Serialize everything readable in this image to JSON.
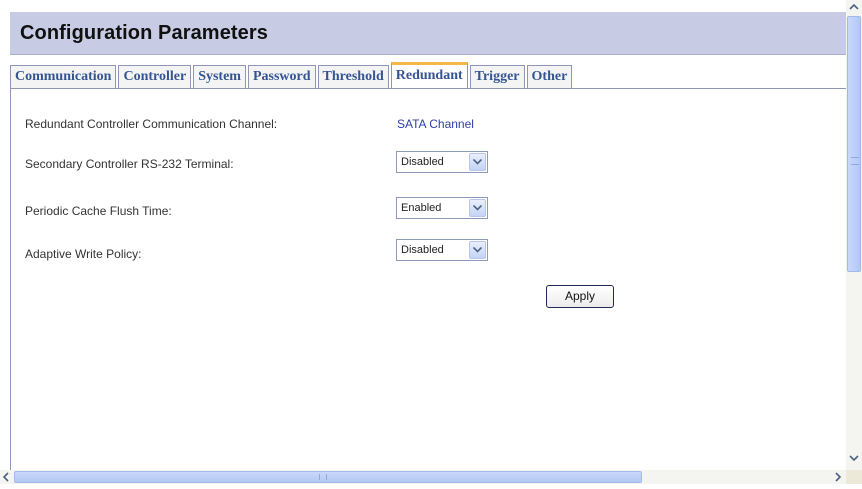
{
  "header": {
    "title": "Configuration Parameters"
  },
  "tabs": [
    {
      "label": "Communication",
      "active": false
    },
    {
      "label": "Controller",
      "active": false
    },
    {
      "label": "System",
      "active": false
    },
    {
      "label": "Password",
      "active": false
    },
    {
      "label": "Threshold",
      "active": false
    },
    {
      "label": "Redundant",
      "active": true
    },
    {
      "label": "Trigger",
      "active": false
    },
    {
      "label": "Other",
      "active": false
    }
  ],
  "form": {
    "channel": {
      "label": "Redundant Controller Communication Channel:",
      "value": "SATA Channel"
    },
    "rs232": {
      "label": "Secondary Controller RS-232 Terminal:",
      "value": "Disabled"
    },
    "cache_flush": {
      "label": "Periodic Cache Flush Time:",
      "value": "Enabled"
    },
    "write_policy": {
      "label": "Adaptive Write Policy:",
      "value": "Disabled"
    },
    "apply_label": "Apply"
  },
  "colors": {
    "title_bar": "#c7cce4",
    "tab_text": "#355592",
    "active_tab_accent": "#f5b847",
    "link_value": "#2b3fa6",
    "scrollbar_thumb": "#c4d4fa"
  },
  "icons": {
    "select_arrow": "chevron-down-icon",
    "scroll_up": "arrow-up-icon",
    "scroll_down": "arrow-down-icon",
    "scroll_left": "arrow-left-icon",
    "scroll_right": "arrow-right-icon"
  }
}
